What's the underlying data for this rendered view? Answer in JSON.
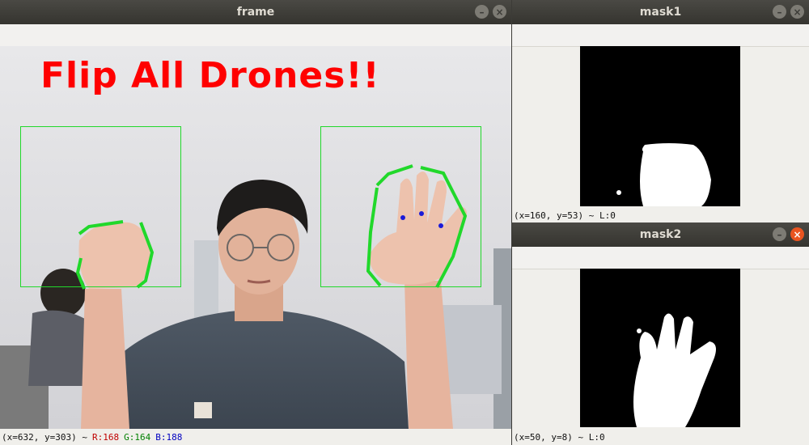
{
  "windows": {
    "frame": {
      "title": "frame",
      "overlay_text": "Flip All Drones!!",
      "status": {
        "coords": "(x=632, y=303) ~",
        "r": "R:168",
        "g": "G:164",
        "b": "B:188"
      }
    },
    "mask1": {
      "title": "mask1",
      "status": {
        "coords": "(x=160, y=53) ~ L:0"
      }
    },
    "mask2": {
      "title": "mask2",
      "status": {
        "coords": "(x=50, y=8) ~ L:0"
      }
    }
  },
  "buttons": {
    "minimize": "–",
    "close": "×"
  },
  "colors": {
    "title_bar": "#3c3b37",
    "overlay_text": "#ff0000",
    "roi_box": "#21d82b",
    "contour": "#21d82b",
    "keypoints": "#1a1ad8",
    "close_active": "#e95420"
  }
}
